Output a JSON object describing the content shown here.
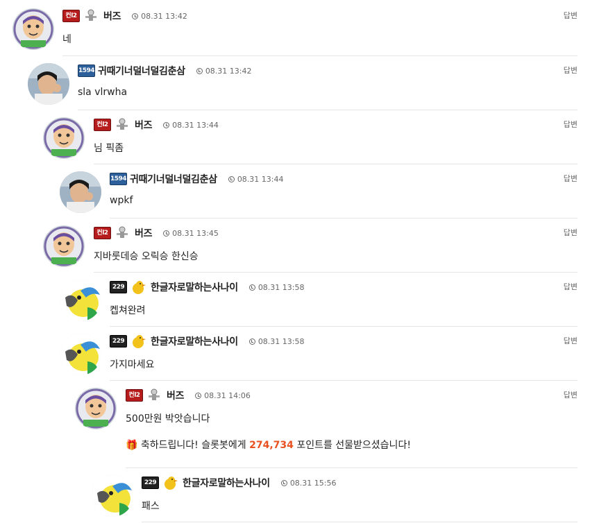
{
  "reply_label": "답변",
  "comments": [
    {
      "nick": "버즈",
      "badge": "컨l2",
      "time": "08.31 13:42",
      "text": "네"
    },
    {
      "nick": "귀때기너덜너덜김춘삼",
      "badge": "1594",
      "time": "08.31 13:42",
      "text": "sla vlrwha"
    },
    {
      "nick": "버즈",
      "badge": "컨l2",
      "time": "08.31 13:44",
      "text": "님 픽좀"
    },
    {
      "nick": "귀때기너덜너덜김춘삼",
      "badge": "1594",
      "time": "08.31 13:44",
      "text": "wpkf"
    },
    {
      "nick": "버즈",
      "badge": "컨l2",
      "time": "08.31 13:45",
      "text": "지바룻데승 오릭승 한신승"
    },
    {
      "nick": "한글자로말하는사나이",
      "badge": "229",
      "time": "08.31 13:58",
      "text": "켑쳐완려"
    },
    {
      "nick": "한글자로말하는사나이",
      "badge": "229",
      "time": "08.31 13:58",
      "text": "가지마세요"
    },
    {
      "nick": "버즈",
      "badge": "컨l2",
      "time": "08.31 14:06",
      "text": "500만원 박앗습니다"
    },
    {
      "nick": "한글자로말하는사나이",
      "badge": "229",
      "time": "08.31 15:56",
      "text": "패스"
    }
  ],
  "gift": {
    "prefix": "축하드립니다! 슬롯봇에게",
    "points": "274,734",
    "suffix": "포인트를 선물받으셨습니다!"
  },
  "colors": {
    "points": "#e8501f",
    "divider": "#e5e5e5"
  }
}
